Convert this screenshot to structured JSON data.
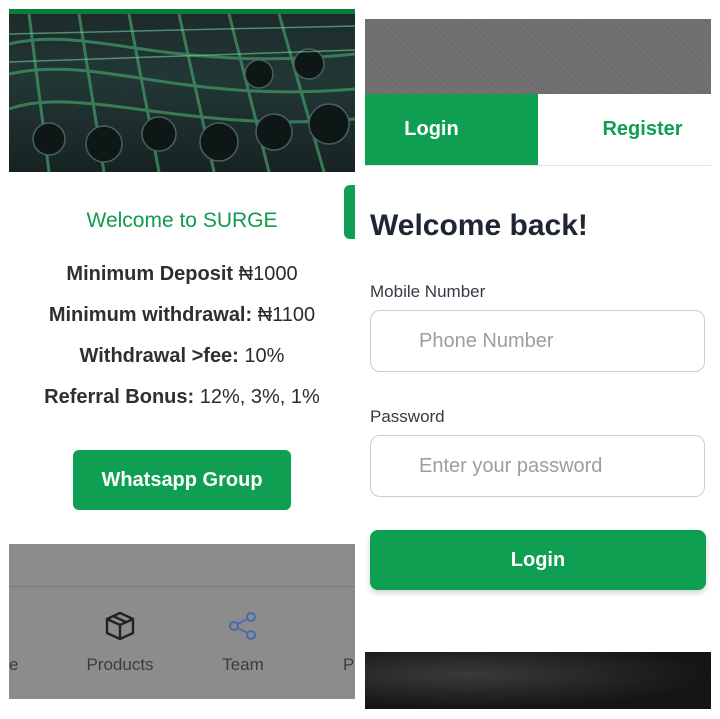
{
  "left_screen": {
    "welcome": "Welcome to SURGE",
    "info_lines": [
      {
        "label": "Minimum Deposit ",
        "value": "₦1000"
      },
      {
        "label": "Minimum withdrawal: ",
        "value": "₦1100"
      },
      {
        "label": "Withdrawal >fee: ",
        "value": "10%"
      },
      {
        "label": "Referral Bonus: ",
        "value": "12%, 3%, 1%"
      }
    ],
    "whatsapp_button": "Whatsapp Group",
    "bottom_nav": [
      {
        "label": "e",
        "icon": "home-icon"
      },
      {
        "label": "Products",
        "icon": "box-icon"
      },
      {
        "label": "Team",
        "icon": "share-icon"
      },
      {
        "label": "P",
        "icon": "profile-icon"
      }
    ]
  },
  "right_screen": {
    "tabs": {
      "login": "Login",
      "register": "Register"
    },
    "title": "Welcome back!",
    "mobile": {
      "label": "Mobile Number",
      "placeholder": "Phone Number"
    },
    "password": {
      "label": "Password",
      "placeholder": "Enter your password"
    },
    "login_button": "Login"
  },
  "colors": {
    "accent": "#0f9f52",
    "dark_accent": "#0a7d3a"
  }
}
